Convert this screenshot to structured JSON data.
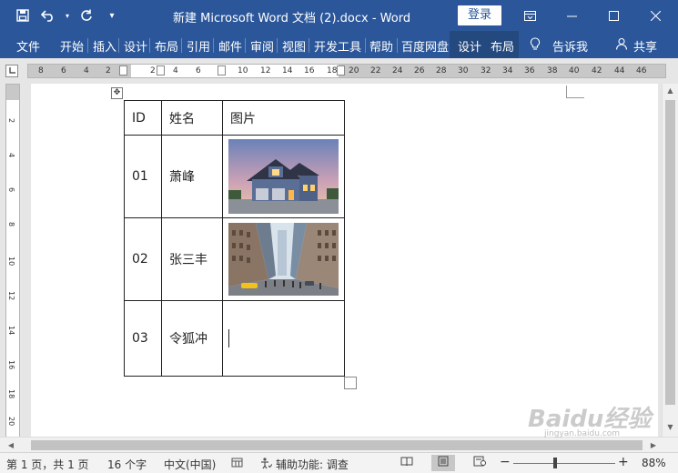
{
  "window": {
    "title": "新建 Microsoft Word 文档 (2).docx  -  Word",
    "login_label": "登录"
  },
  "ribbon": {
    "tabs": [
      "文件",
      "开始",
      "插入",
      "设计",
      "布局",
      "引用",
      "邮件",
      "审阅",
      "视图",
      "开发工具",
      "帮助",
      "百度网盘"
    ],
    "context_tabs": [
      "设计",
      "布局"
    ],
    "tell_me": "告诉我",
    "share": "共享"
  },
  "ruler": {
    "h_numbers_left": [
      "8",
      "6",
      "4",
      "2"
    ],
    "h_numbers_active": [
      "2",
      "4",
      "6"
    ],
    "h_numbers_right": [
      "10",
      "12",
      "14",
      "16",
      "18",
      "20",
      "22",
      "24",
      "26",
      "28",
      "30",
      "32",
      "34",
      "36",
      "38",
      "40",
      "42",
      "44",
      "46"
    ],
    "v_numbers": [
      "2",
      "4",
      "6",
      "8",
      "10",
      "12",
      "14",
      "16",
      "18",
      "20"
    ]
  },
  "table": {
    "headers": [
      "ID",
      "姓名",
      "图片"
    ],
    "rows": [
      {
        "id": "01",
        "name": "萧峰",
        "image": "house-photo"
      },
      {
        "id": "02",
        "name": "张三丰",
        "image": "city-street-photo"
      },
      {
        "id": "03",
        "name": "令狐冲",
        "image": ""
      }
    ]
  },
  "status": {
    "page": "第 1 页，共 1 页",
    "words": "16 个字",
    "language": "中文(中国)",
    "accessibility": "辅助功能: 调查",
    "zoom": "88%",
    "zoom_level": 0.88
  },
  "watermark": {
    "brand": "Baidu经验",
    "sub": "jingyan.baidu.com"
  }
}
